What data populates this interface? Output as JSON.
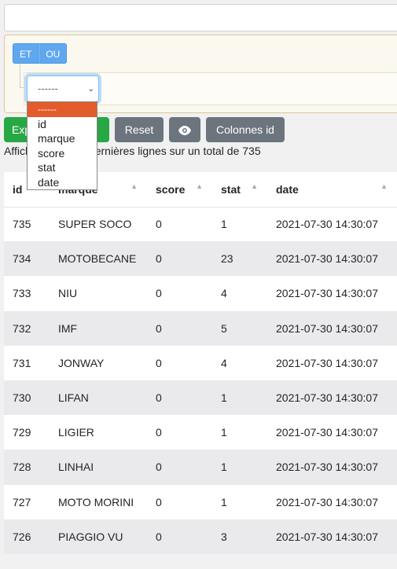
{
  "query_builder": {
    "conditions": [
      "ET",
      "OU"
    ],
    "rule_select_value": "------",
    "field_options": [
      "------",
      "id",
      "marque",
      "score",
      "stat",
      "date"
    ]
  },
  "toolbar": {
    "export_label": "Exporter la liste",
    "reset_label": "Reset",
    "view_icon": "eye-icon",
    "columns_label": "Colonnes id"
  },
  "info": "Affichage des 10 dernières lignes sur un total de 735",
  "table": {
    "headers": [
      "id",
      "marque",
      "score",
      "stat",
      "date"
    ],
    "rows": [
      [
        "735",
        "SUPER SOCO",
        "0",
        "1",
        "2021-07-30 14:30:07"
      ],
      [
        "734",
        "MOTOBECANE",
        "0",
        "23",
        "2021-07-30 14:30:07"
      ],
      [
        "733",
        "NIU",
        "0",
        "4",
        "2021-07-30 14:30:07"
      ],
      [
        "732",
        "IMF",
        "0",
        "5",
        "2021-07-30 14:30:07"
      ],
      [
        "731",
        "JONWAY",
        "0",
        "4",
        "2021-07-30 14:30:07"
      ],
      [
        "730",
        "LIFAN",
        "0",
        "1",
        "2021-07-30 14:30:07"
      ],
      [
        "729",
        "LIGIER",
        "0",
        "1",
        "2021-07-30 14:30:07"
      ],
      [
        "728",
        "LINHAI",
        "0",
        "1",
        "2021-07-30 14:30:07"
      ],
      [
        "727",
        "MOTO MORINI",
        "0",
        "1",
        "2021-07-30 14:30:07"
      ],
      [
        "726",
        "PIAGGIO VU",
        "0",
        "3",
        "2021-07-30 14:30:07"
      ]
    ]
  },
  "colors": {
    "success": "#28a745",
    "secondary": "#6c757d",
    "condition": "#5fa8f0",
    "selected_option": "#e35c2b"
  }
}
